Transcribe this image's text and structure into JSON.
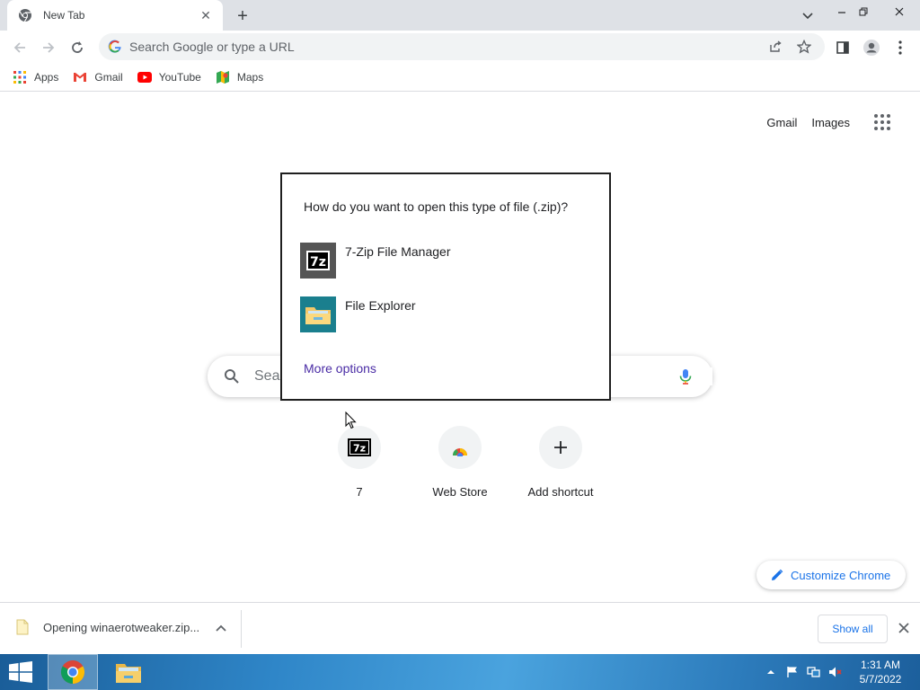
{
  "tab": {
    "title": "New Tab",
    "new_tab": "+"
  },
  "omnibox": {
    "placeholder": "Search Google or type a URL"
  },
  "bookmarks": [
    {
      "label": "Apps",
      "icon": "apps-grid-icon"
    },
    {
      "label": "Gmail",
      "icon": "gmail-icon"
    },
    {
      "label": "YouTube",
      "icon": "youtube-icon"
    },
    {
      "label": "Maps",
      "icon": "maps-icon"
    }
  ],
  "ntp": {
    "gmail": "Gmail",
    "images": "Images",
    "search_placeholder": "Sear",
    "shortcuts": [
      {
        "label": "7",
        "icon": "7zip-icon"
      },
      {
        "label": "Web Store",
        "icon": "web-store-icon"
      },
      {
        "label": "Add shortcut",
        "icon": "plus-icon"
      }
    ],
    "customize": "Customize Chrome"
  },
  "dialog": {
    "question": "How do you want to open this type of file (.zip)?",
    "options": [
      {
        "name": "7-Zip File Manager",
        "icon": "7zip-icon"
      },
      {
        "name": "File Explorer",
        "icon": "file-explorer-icon"
      }
    ],
    "more": "More options"
  },
  "download": {
    "filename": "Opening winaerotweaker.zip...",
    "show_all": "Show all"
  },
  "taskbar": {
    "time": "1:31 AM",
    "date": "5/7/2022"
  },
  "colors": {
    "accent": "#1a73e8",
    "link_visited": "#4a2ca5",
    "tab_strip": "#dee1e6"
  }
}
